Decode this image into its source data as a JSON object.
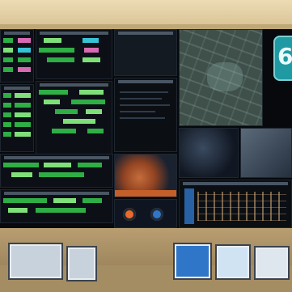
{
  "image": {
    "badge_text": "6"
  },
  "colors": {
    "green": "#2fae45",
    "bright_green": "#7fe07a",
    "pink": "#d66ab3",
    "cyan": "#37c2d6",
    "orange": "#e96b2c",
    "blue": "#2f76c8"
  }
}
